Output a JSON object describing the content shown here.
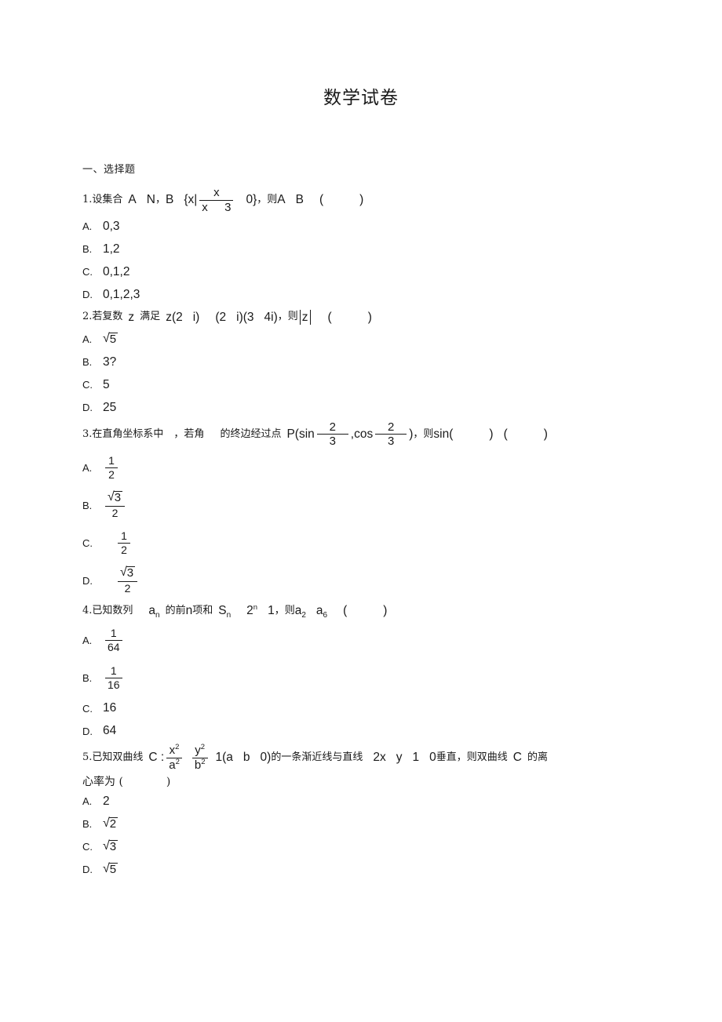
{
  "document": {
    "title": "数学试卷",
    "section_heading": "一、选择题"
  },
  "questions": [
    {
      "number": "1.",
      "stem_parts": {
        "lead": "设集合",
        "set_a": "A",
        "set_n": "N",
        "comma": "，",
        "set_b": "B",
        "brace_open": "{x|",
        "frac_num": "x",
        "frac_den_left": "x",
        "frac_den_right": "3",
        "zero_brace": "0}",
        "then": "，则",
        "op_a": "A",
        "op_b": "B",
        "paren_open": "(",
        "paren_close": ")"
      },
      "options": [
        {
          "label": "A.",
          "text": "0,3"
        },
        {
          "label": "B.",
          "text": "1,2"
        },
        {
          "label": "C.",
          "text": "0,1,2"
        },
        {
          "label": "D.",
          "text": "0,1,2,3"
        }
      ]
    },
    {
      "number": "2.",
      "stem_parts": {
        "lead": "若复数",
        "var_z": "z",
        "satisfy": "满足",
        "expr1": "z(2",
        "expr2": "i)",
        "expr3": "(2",
        "expr4": "i)(3",
        "expr5": "4i)",
        "then": "，则",
        "abs_z": "z",
        "paren_open": "(",
        "paren_close": ")"
      },
      "options": [
        {
          "label": "A.",
          "sqrt": "5"
        },
        {
          "label": "B.",
          "text": "3?"
        },
        {
          "label": "C.",
          "text": "5"
        },
        {
          "label": "D.",
          "text": "25"
        }
      ]
    },
    {
      "number": "3.",
      "stem_parts": {
        "lead": "在直角坐标系中",
        "comma1": "，若角",
        "mid": "的终边经过点",
        "point_p": "P(sin",
        "frac1_num": "2",
        "frac1_den": "3",
        "cos_part": ",cos",
        "frac2_num": "2",
        "frac2_den": "3",
        "close_p": ")",
        "then": "，则",
        "sin_open": "sin(",
        "sin_close": ")",
        "paren_open": "(",
        "paren_close": ")"
      },
      "options": [
        {
          "label": "A.",
          "frac_num": "1",
          "frac_den": "2",
          "indent": false
        },
        {
          "label": "B.",
          "frac_sqrt": "3",
          "frac_den": "2",
          "indent": false
        },
        {
          "label": "C.",
          "frac_num": "1",
          "frac_den": "2",
          "indent": true
        },
        {
          "label": "D.",
          "frac_sqrt": "3",
          "frac_den": "2",
          "indent": true
        }
      ]
    },
    {
      "number": "4.",
      "stem_parts": {
        "lead": "已知数列",
        "seq_a": "a",
        "seq_a_sub": "n",
        "mid": "的前",
        "var_n": "n",
        "terms": "项和",
        "sum_s": "S",
        "sum_s_sub": "n",
        "two": "2",
        "two_sup": "n",
        "one": "1",
        "then": "，则",
        "a2": "a",
        "a2_sub": "2",
        "a6": "a",
        "a6_sub": "6",
        "paren_open": "(",
        "paren_close": ")"
      },
      "options": [
        {
          "label": "A.",
          "frac_num": "1",
          "frac_den": "64"
        },
        {
          "label": "B.",
          "frac_num": "1",
          "frac_den": "16"
        },
        {
          "label": "C.",
          "text": "16"
        },
        {
          "label": "D.",
          "text": "64"
        }
      ]
    },
    {
      "number": "5.",
      "stem_parts": {
        "lead": "已知双曲线",
        "curve_c": "C :",
        "f1_num": "x",
        "f1_num_sup": "2",
        "f1_den": "a",
        "f1_den_sup": "2",
        "f2_num": "y",
        "f2_num_sup": "2",
        "f2_den": "b",
        "f2_den_sup": "2",
        "one_a": "1(a",
        "b_sym": "b",
        "zero_close": "0)",
        "mid": "的一条渐近线与直线",
        "line_2x": "2x",
        "line_y": "y",
        "line_1": "1",
        "line_0": "0",
        "perp": "垂直，则双曲线",
        "c_ref": "C",
        "tail": "的离",
        "line2": "心率为 (",
        "line2_close": ")"
      },
      "options": [
        {
          "label": "A.",
          "text": "2"
        },
        {
          "label": "B.",
          "sqrt": "2"
        },
        {
          "label": "C.",
          "sqrt": "3"
        },
        {
          "label": "D.",
          "sqrt": "5"
        }
      ]
    }
  ]
}
